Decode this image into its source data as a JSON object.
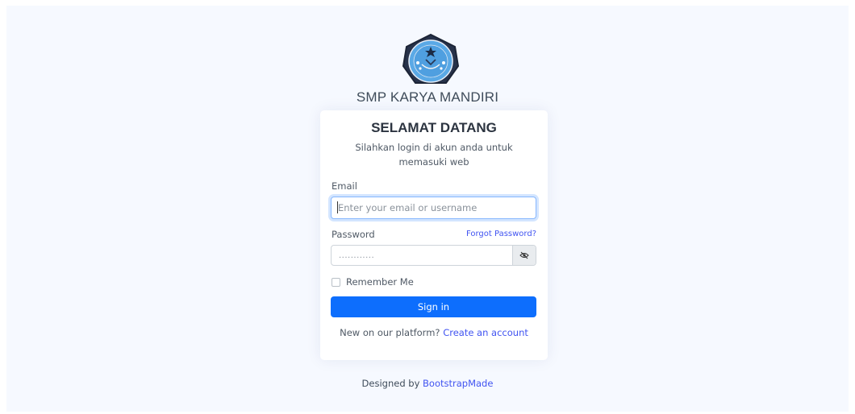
{
  "header": {
    "school_name": "SMP KARYA MANDIRI",
    "logo_icon": "school-crest-icon"
  },
  "login": {
    "title": "SELAMAT DATANG",
    "subtitle": "Silahkan login di akun anda untuk memasuki web",
    "email_label": "Email",
    "email_value": "",
    "email_placeholder": "Enter your email or username",
    "password_label": "Password",
    "forgot_password": "Forgot Password?",
    "password_value": "............",
    "toggle_icon": "eye-slash-icon",
    "remember_label": "Remember Me",
    "remember_checked": false,
    "signin_label": "Sign in",
    "register_prompt": "New on our platform?",
    "register_link": "Create an account"
  },
  "footer": {
    "credit_prefix": "Designed by",
    "credit_link": "BootstrapMade"
  },
  "colors": {
    "primary": "#0d6efd",
    "link": "#4154f1",
    "background": "#f6f9ff"
  }
}
